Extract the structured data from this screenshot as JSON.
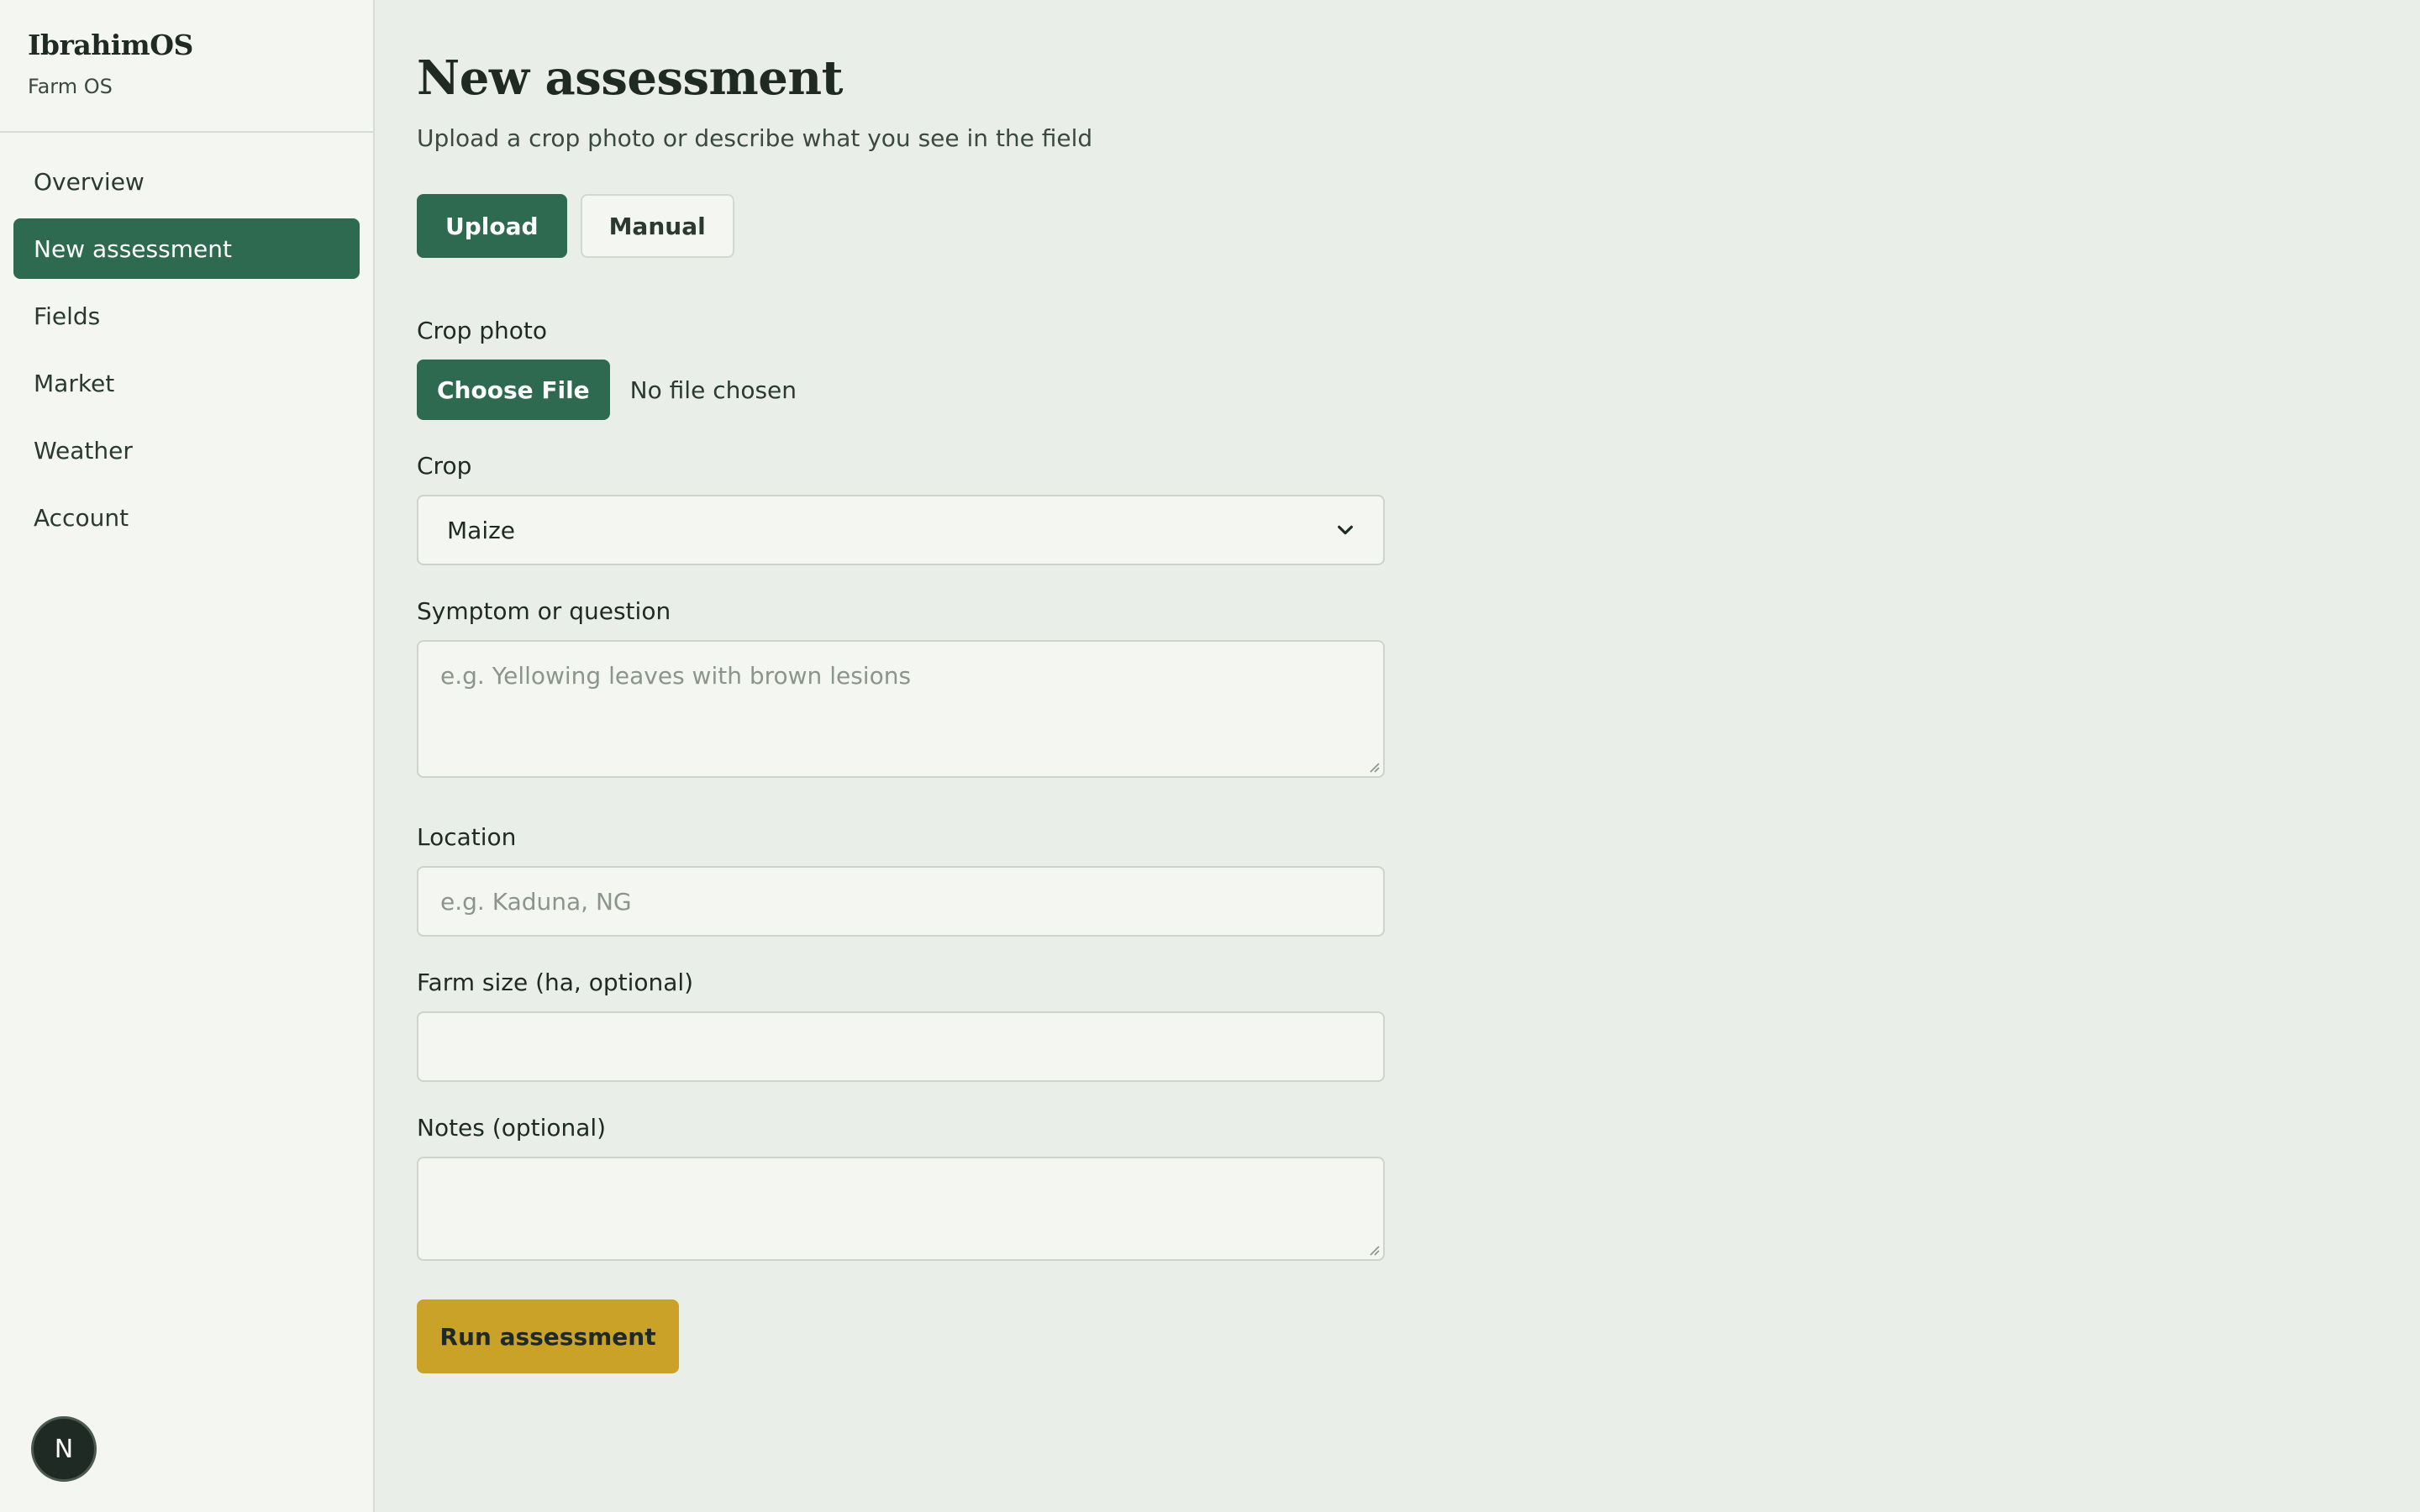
{
  "brand": {
    "name": "IbrahimOS",
    "subtitle": "Farm OS"
  },
  "sidebar": {
    "items": [
      {
        "label": "Overview"
      },
      {
        "label": "New assessment",
        "active": true
      },
      {
        "label": "Fields"
      },
      {
        "label": "Market"
      },
      {
        "label": "Weather"
      },
      {
        "label": "Account"
      }
    ],
    "avatar_initial": "N"
  },
  "page": {
    "title": "New assessment",
    "subtitle": "Upload a crop photo or describe what you see in the field"
  },
  "tabs": [
    {
      "label": "Upload",
      "active": true
    },
    {
      "label": "Manual",
      "active": false
    }
  ],
  "form": {
    "photo": {
      "label": "Crop photo",
      "button_label": "Choose File",
      "status": "No file chosen"
    },
    "crop": {
      "label": "Crop",
      "value": "Maize"
    },
    "symptom": {
      "label": "Symptom or question",
      "placeholder": "e.g. Yellowing leaves with brown lesions"
    },
    "location": {
      "label": "Location",
      "placeholder": "e.g. Kaduna, NG"
    },
    "farm_size": {
      "label": "Farm size (ha, optional)",
      "value": ""
    },
    "notes": {
      "label": "Notes (optional)",
      "value": ""
    },
    "submit_label": "Run assessment"
  },
  "colors": {
    "primary": "#2d6a4f",
    "accent": "#c9a227",
    "background": "#e9eee8",
    "sidebar": "#f4f6f2"
  },
  "icons": {
    "select_chevron": "chevron-down-icon",
    "avatar": "avatar-n-icon"
  }
}
